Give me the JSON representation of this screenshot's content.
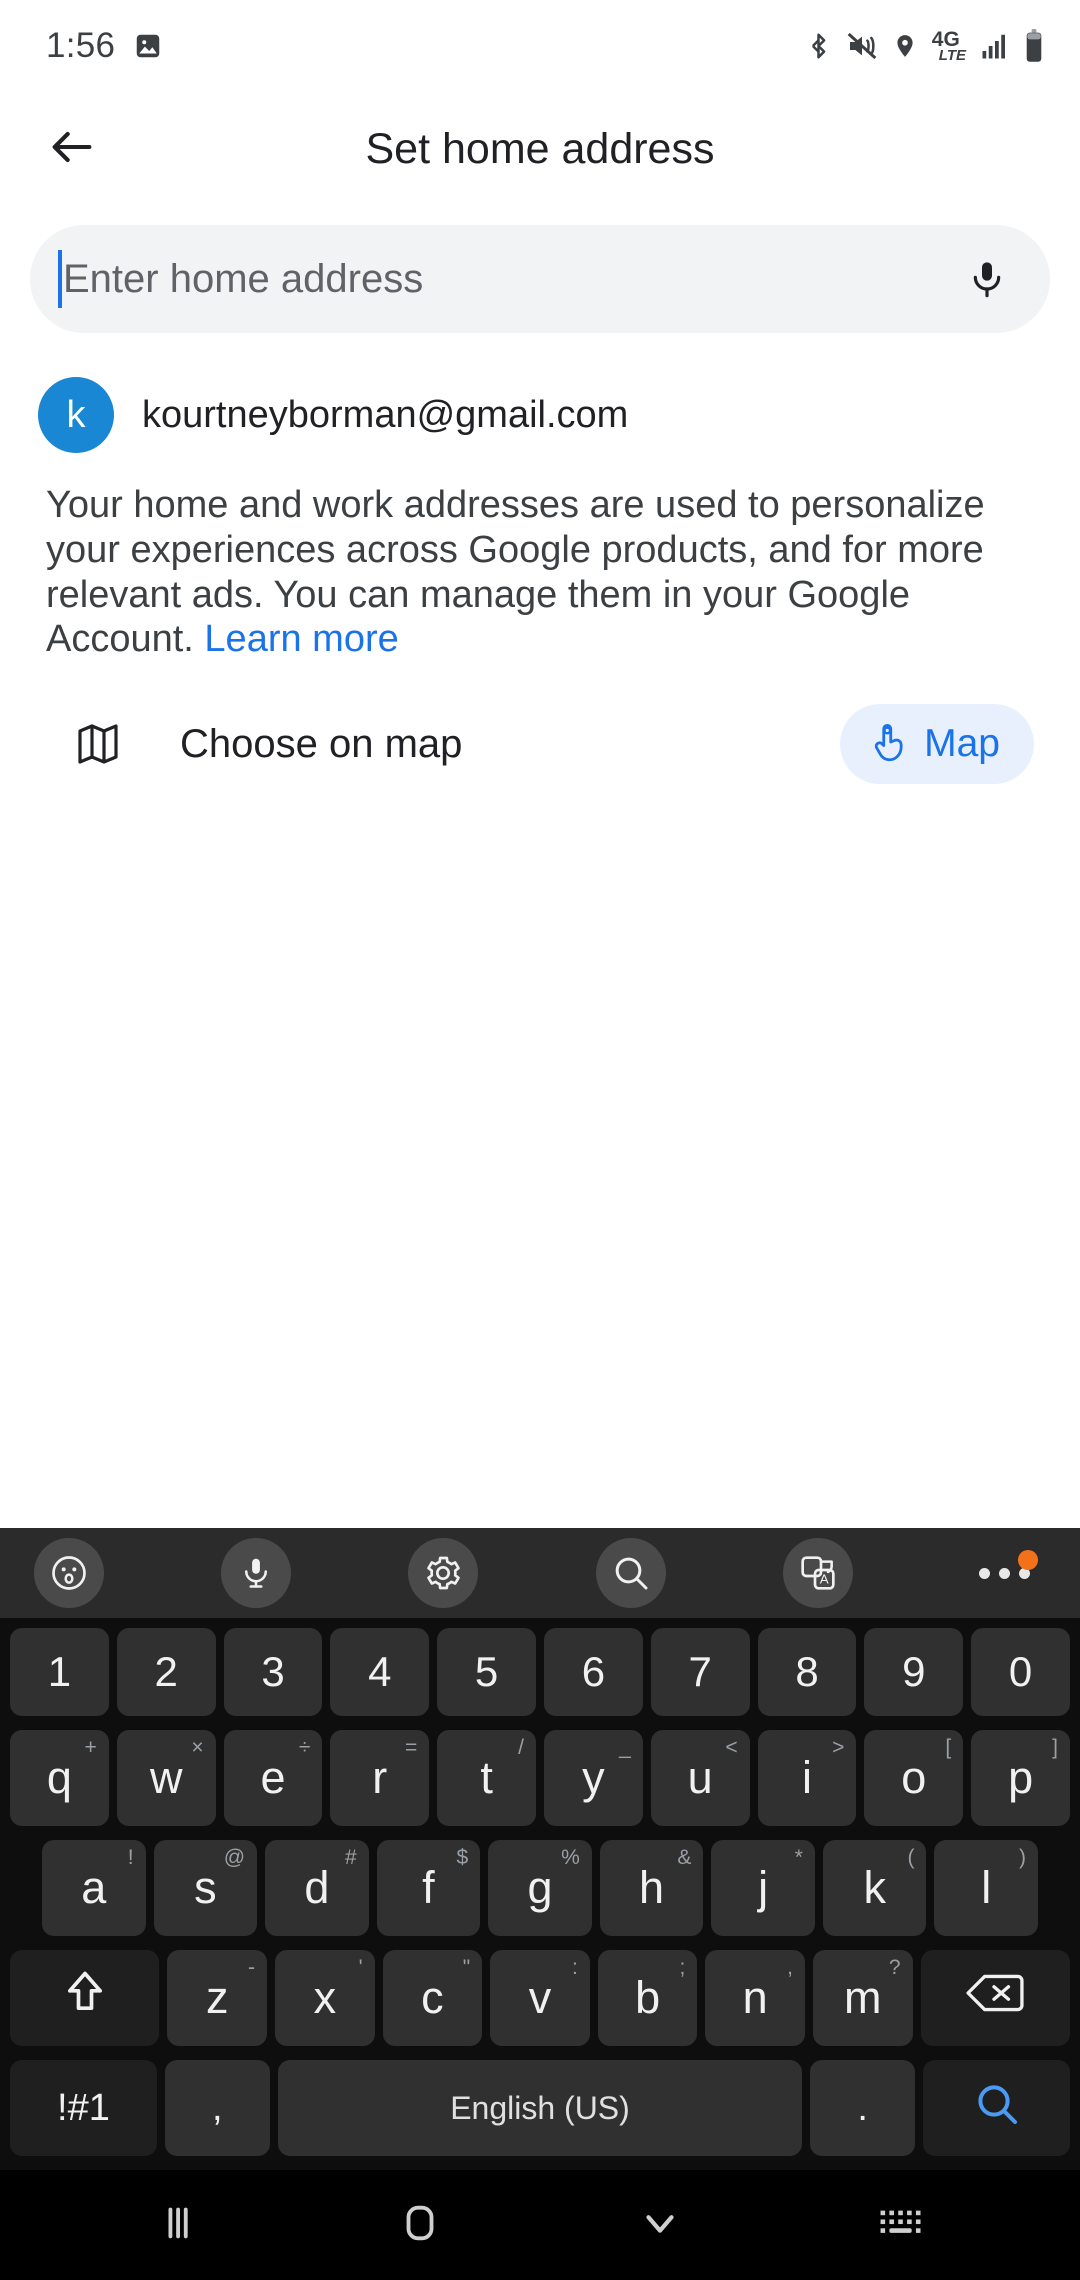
{
  "status_bar": {
    "time": "1:56",
    "left_icons": [
      "image-icon"
    ],
    "right_icons": [
      "bluetooth-icon",
      "mute-vibrate-icon",
      "location-icon",
      "4g-lte-icon",
      "signal-icon",
      "battery-icon"
    ],
    "network_label": "4G",
    "network_sublabel": "LTE"
  },
  "appbar": {
    "title": "Set home address",
    "back_icon": "arrow-back-icon"
  },
  "search": {
    "placeholder": "Enter home address",
    "value": "",
    "mic_icon": "microphone-icon",
    "caret_color": "#1a73e8"
  },
  "account": {
    "avatar_letter": "k",
    "avatar_color": "#1a87d4",
    "email": "kourtneyborman@gmail.com"
  },
  "description": {
    "text": "Your home and work addresses are used to personalize your experiences across Google products, and for more relevant ads. You can manage them in your Google Account. ",
    "link_label": "Learn more",
    "link_color": "#1a73e8"
  },
  "choose_map": {
    "icon": "map-icon",
    "label": "Choose on map",
    "button_label": "Map",
    "button_icon": "tap-gesture-icon",
    "button_bg": "#e8f0fe",
    "button_fg": "#1a73e8"
  },
  "keyboard": {
    "toolbar": [
      {
        "name": "emoji-icon"
      },
      {
        "name": "voice-input-icon"
      },
      {
        "name": "gear-icon"
      },
      {
        "name": "search-icon"
      },
      {
        "name": "translate-icon"
      }
    ],
    "more_icon": "more-horizontal-icon",
    "badge_color": "#f4701b",
    "rows": {
      "numbers": [
        "1",
        "2",
        "3",
        "4",
        "5",
        "6",
        "7",
        "8",
        "9",
        "0"
      ],
      "top": [
        {
          "main": "q",
          "sup": "+"
        },
        {
          "main": "w",
          "sup": "×"
        },
        {
          "main": "e",
          "sup": "÷"
        },
        {
          "main": "r",
          "sup": "="
        },
        {
          "main": "t",
          "sup": "/"
        },
        {
          "main": "y",
          "sup": "_"
        },
        {
          "main": "u",
          "sup": "<"
        },
        {
          "main": "i",
          "sup": ">"
        },
        {
          "main": "o",
          "sup": "["
        },
        {
          "main": "p",
          "sup": "]"
        }
      ],
      "home": [
        {
          "main": "a",
          "sup": "!"
        },
        {
          "main": "s",
          "sup": "@"
        },
        {
          "main": "d",
          "sup": "#"
        },
        {
          "main": "f",
          "sup": "$"
        },
        {
          "main": "g",
          "sup": "%"
        },
        {
          "main": "h",
          "sup": "&"
        },
        {
          "main": "j",
          "sup": "*"
        },
        {
          "main": "k",
          "sup": "("
        },
        {
          "main": "l",
          "sup": ")"
        }
      ],
      "bottom": [
        {
          "main": "z",
          "sup": "-"
        },
        {
          "main": "x",
          "sup": "'"
        },
        {
          "main": "c",
          "sup": "\""
        },
        {
          "main": "v",
          "sup": ":"
        },
        {
          "main": "b",
          "sup": ";"
        },
        {
          "main": "n",
          "sup": ","
        },
        {
          "main": "m",
          "sup": "?"
        }
      ],
      "shift_icon": "shift-icon",
      "backspace_icon": "backspace-icon",
      "symbols_label": "!#1",
      "comma_label": ",",
      "space_label": "English (US)",
      "period_label": ".",
      "enter_icon": "search-icon",
      "enter_color": "#4a9bf5"
    }
  },
  "navbar": {
    "recents_icon": "recents-icon",
    "home_icon": "home-icon",
    "dismiss_keyboard_icon": "chevron-down-icon",
    "keyboard_switch_icon": "keyboard-switch-icon"
  }
}
